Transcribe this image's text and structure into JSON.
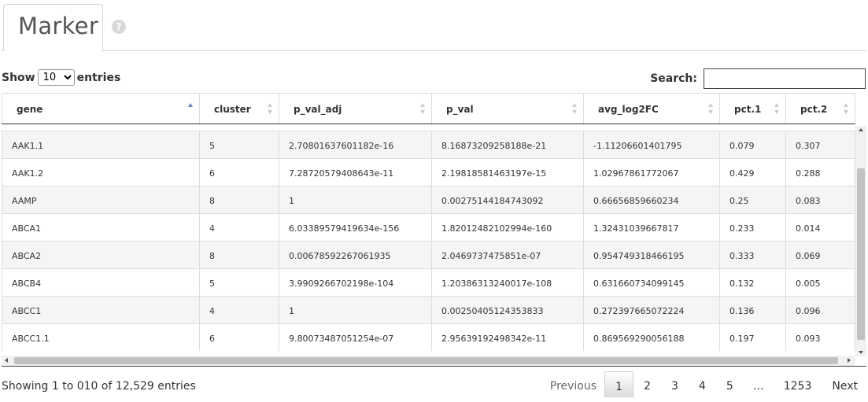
{
  "tab": {
    "title": "Marker",
    "help_icon": "?"
  },
  "length": {
    "prefix": "Show",
    "value": "10",
    "suffix": "entries"
  },
  "search": {
    "label": "Search:",
    "value": "",
    "placeholder": ""
  },
  "table": {
    "sort_column": "gene",
    "columns": [
      {
        "key": "gene",
        "label": "gene"
      },
      {
        "key": "cluster",
        "label": "cluster"
      },
      {
        "key": "p_val_adj",
        "label": "p_val_adj"
      },
      {
        "key": "p_val",
        "label": "p_val"
      },
      {
        "key": "avg_log2FC",
        "label": "avg_log2FC"
      },
      {
        "key": "pct1",
        "label": "pct.1"
      },
      {
        "key": "pct2",
        "label": "pct.2"
      }
    ],
    "rows": [
      [
        "AAK1.1",
        "5",
        "2.70801637601182e-16",
        "8.16873209258188e-21",
        "-1.11206601401795",
        "0.079",
        "0.307"
      ],
      [
        "AAK1.2",
        "6",
        "7.28720579408643e-11",
        "2.19818581463197e-15",
        "1.02967861772067",
        "0.429",
        "0.288"
      ],
      [
        "AAMP",
        "8",
        "1",
        "0.00275144184743092",
        "0.66656859660234",
        "0.25",
        "0.083"
      ],
      [
        "ABCA1",
        "4",
        "6.03389579419634e-156",
        "1.82012482102994e-160",
        "1.32431039667817",
        "0.233",
        "0.014"
      ],
      [
        "ABCA2",
        "8",
        "0.00678592267061935",
        "2.0469737475851e-07",
        "0.954749318466195",
        "0.333",
        "0.069"
      ],
      [
        "ABCB4",
        "5",
        "3.9909266702198e-104",
        "1.20386313240017e-108",
        "0.631660734099145",
        "0.132",
        "0.005"
      ],
      [
        "ABCC1",
        "4",
        "1",
        "0.00250405124353833",
        "0.272397665072224",
        "0.136",
        "0.096"
      ],
      [
        "ABCC1.1",
        "6",
        "9.80073487051254e-07",
        "2.95639192498342e-11",
        "0.869569290056188",
        "0.197",
        "0.093"
      ]
    ]
  },
  "info": "Showing 1 to 010 of 12,529 entries",
  "pagination": {
    "previous": "Previous",
    "pages": [
      "1",
      "2",
      "3",
      "4",
      "5"
    ],
    "ellipsis": "…",
    "last": "1253",
    "next": "Next",
    "current": "1"
  }
}
